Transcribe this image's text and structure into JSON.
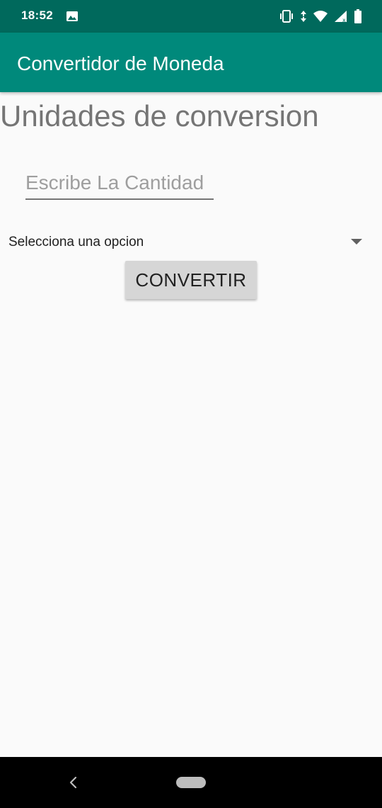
{
  "status_bar": {
    "time": "18:52",
    "left_icons": [
      "image-icon"
    ],
    "right_icons": [
      "vibrate-icon",
      "data-arrows-icon",
      "wifi-icon",
      "signal-icon",
      "battery-icon"
    ]
  },
  "app_bar": {
    "title": "Convertidor de Moneda",
    "color": "#00897b"
  },
  "main": {
    "heading": "Unidades de conversion",
    "amount_input": {
      "value": "",
      "placeholder": "Escribe La Cantidad"
    },
    "spinner": {
      "selected": "Selecciona una opcion"
    },
    "convert_button": {
      "label": "CONVERTIR"
    }
  },
  "nav_bar": {
    "icons": [
      "back-icon",
      "home-pill-icon"
    ]
  },
  "colors": {
    "status_bar": "#00695c",
    "app_bar": "#00897b",
    "background": "#fafafa",
    "button": "#d6d6d6"
  }
}
